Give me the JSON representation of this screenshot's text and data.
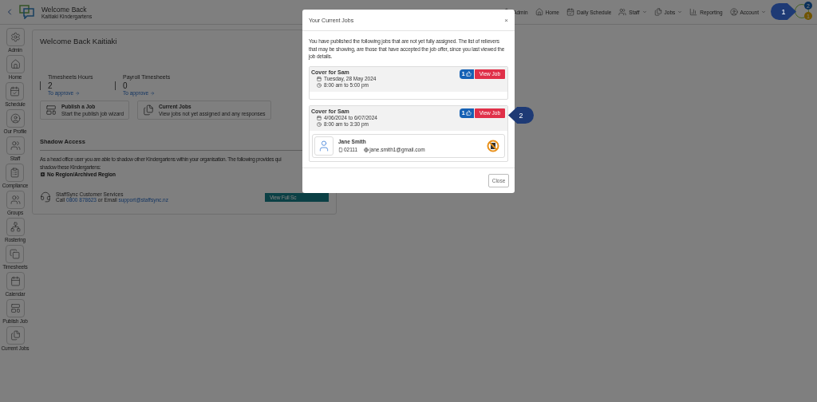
{
  "header": {
    "title": "Welcome Back",
    "subtitle": "Kaitiaki Kindergartens"
  },
  "top_nav": [
    {
      "label": "Admin",
      "kind": "admin",
      "dropdown": false
    },
    {
      "label": "Home",
      "kind": "home",
      "dropdown": false
    },
    {
      "label": "Daily Schedule",
      "kind": "schedule",
      "dropdown": false
    },
    {
      "label": "Staff",
      "kind": "staff",
      "dropdown": true
    },
    {
      "label": "Jobs",
      "kind": "jobs",
      "dropdown": true
    },
    {
      "label": "Reporting",
      "kind": "reporting",
      "dropdown": false
    },
    {
      "label": "Account",
      "kind": "account",
      "dropdown": true
    }
  ],
  "notifications": {
    "messages": "2",
    "alerts": "1"
  },
  "sidebar": {
    "items": [
      {
        "label": "Admin",
        "kind": "admin"
      },
      {
        "label": "Home",
        "kind": "home"
      },
      {
        "label": "Schedule",
        "kind": "schedule"
      },
      {
        "label": "Our Profile",
        "kind": "profile"
      },
      {
        "label": "Staff",
        "kind": "staff"
      },
      {
        "label": "Compliance",
        "kind": "compliance"
      },
      {
        "label": "Groups",
        "kind": "groups"
      },
      {
        "label": "Rostering",
        "kind": "rostering"
      },
      {
        "label": "Timesheets",
        "kind": "timesheets"
      },
      {
        "label": "Calendar",
        "kind": "calendar"
      },
      {
        "label": "Publish Job",
        "kind": "publish"
      },
      {
        "label": "Current Jobs",
        "kind": "jobs"
      }
    ]
  },
  "welcome": {
    "title": "Welcome Back Kaitiaki",
    "stats": [
      {
        "label": "Timesheets Hours",
        "value": "2",
        "link": "To approve"
      },
      {
        "label": "Payroll Timesheets",
        "value": "0",
        "link": "To approve"
      }
    ],
    "shortcuts": [
      {
        "title": "Publish a Job",
        "description": "Start the publish job wizard",
        "kind": "publish"
      },
      {
        "title": "Current Jobs",
        "description": "View jobs not yet assigned and any responses",
        "kind": "jobs"
      }
    ]
  },
  "shadow_access": {
    "title": "Shadow Access",
    "lines": [
      "As a head office user you are able to shadow other Kindergartens within your organisation. The following provides qui",
      "shadow these Kindergartens:"
    ],
    "region": "No Region/Archived Region"
  },
  "support": {
    "title": "StaffSync Customer Services",
    "call": "Call",
    "phone": "0800 878623",
    "or_email": "or Email",
    "email": "support@staffsync.nz",
    "button": "View Full Sc"
  },
  "modal": {
    "title": "Your Current Jobs",
    "close": "×",
    "intro": "You have published the following jobs that are not yet fully assigned. The list of relievers that may be showing, are those that have accepted the job offer, since you last viewed the job details.",
    "jobs": [
      {
        "title": "Cover for Sam",
        "date": "Tuesday, 28 May 2024",
        "time": "8:00 am to 5:00 pm",
        "likes": "1",
        "button": "View Job"
      },
      {
        "title": "Cover for Sam",
        "date": "4/06/2024 to 6/07/2024",
        "time": "8:00 am to 3:30 pm",
        "likes": "1",
        "button": "View Job",
        "relievers": [
          {
            "name": "Jane Smith",
            "phone": "02111",
            "email": "jane.smith1@gmail.com"
          }
        ]
      }
    ],
    "footer_button": "Close"
  },
  "callouts": [
    "1",
    "2"
  ]
}
